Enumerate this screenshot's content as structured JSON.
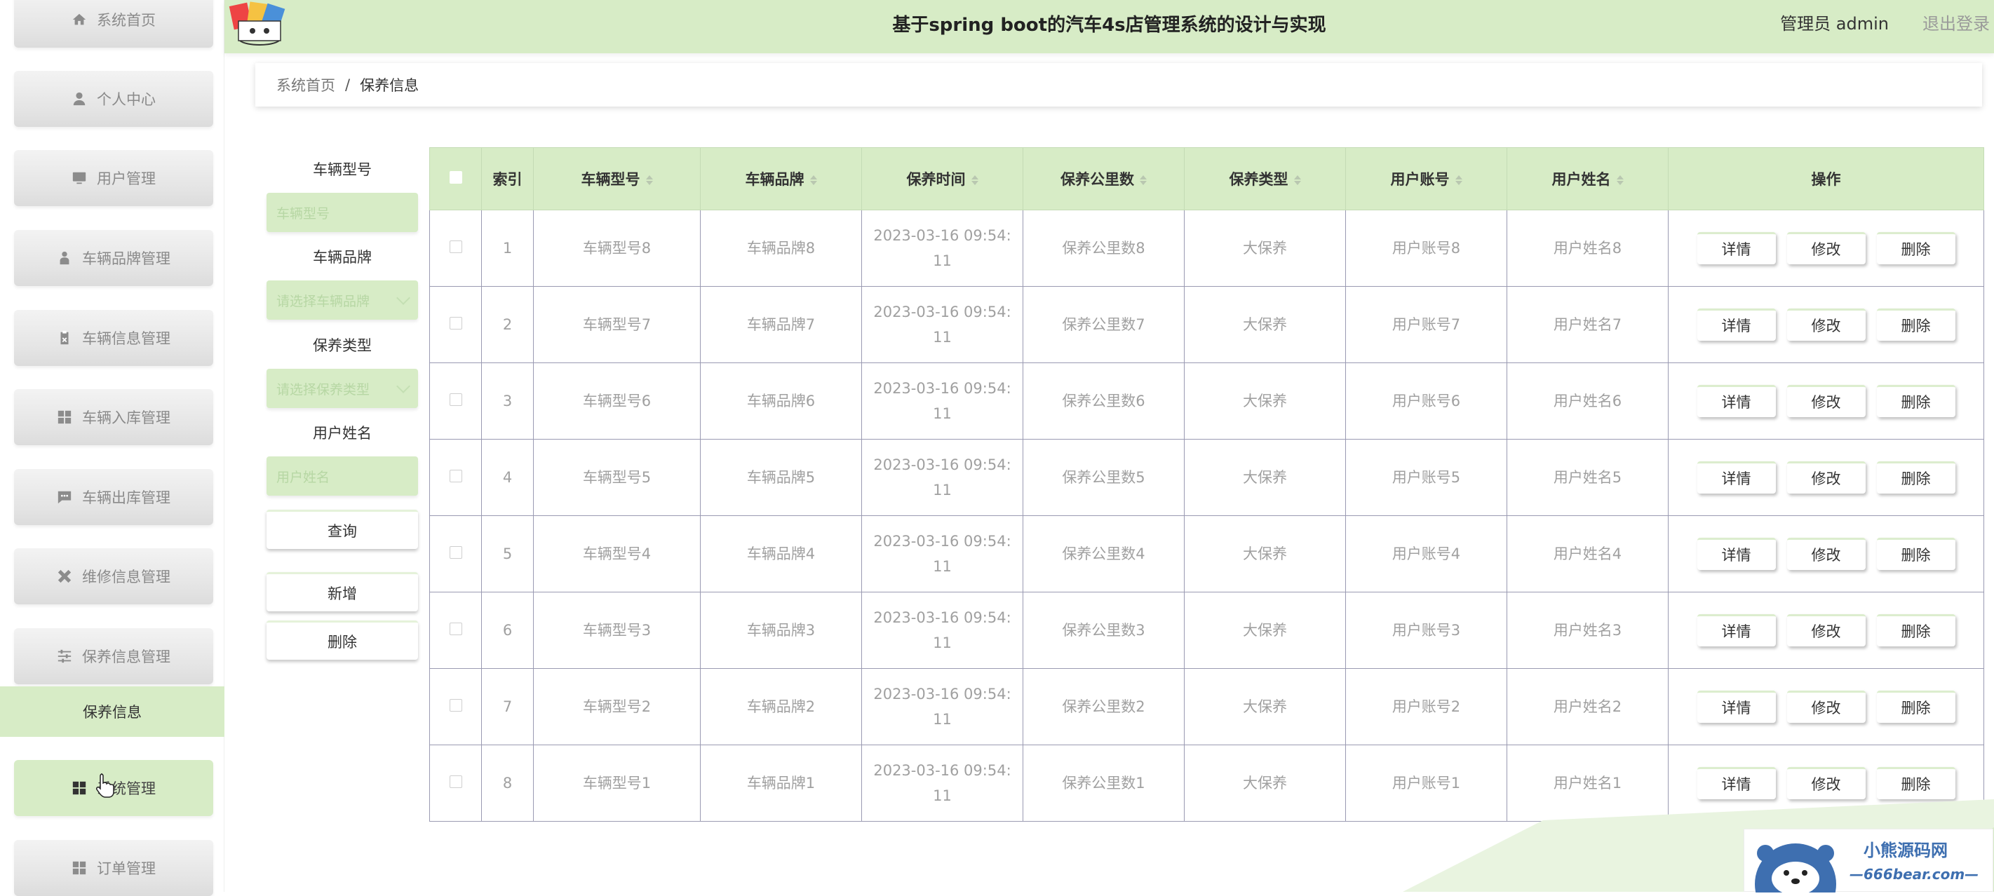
{
  "header": {
    "title": "基于spring boot的汽车4s店管理系统的设计与实现",
    "user": "管理员 admin",
    "logout": "退出登录"
  },
  "sidebar": {
    "items": [
      {
        "label": "系统首页",
        "icon": "home-icon"
      },
      {
        "label": "个人中心",
        "icon": "user-icon"
      },
      {
        "label": "用户管理",
        "icon": "monitor-icon"
      },
      {
        "label": "车辆品牌管理",
        "icon": "person-icon"
      },
      {
        "label": "车辆信息管理",
        "icon": "clipboard-icon"
      },
      {
        "label": "车辆入库管理",
        "icon": "grid-icon"
      },
      {
        "label": "车辆出库管理",
        "icon": "message-icon"
      },
      {
        "label": "维修信息管理",
        "icon": "tools-icon"
      },
      {
        "label": "保养信息管理",
        "icon": "sliders-icon"
      },
      {
        "label": "系统管理",
        "icon": "grid-icon"
      },
      {
        "label": "订单管理",
        "icon": "grid-icon"
      }
    ],
    "sub_item": "保养信息",
    "colors": {
      "accent": "#d7ecc6"
    }
  },
  "breadcrumb": {
    "home": "系统首页",
    "sep": "/",
    "current": "保养信息"
  },
  "filters": {
    "model_label": "车辆型号",
    "model_placeholder": "车辆型号",
    "brand_label": "车辆品牌",
    "brand_placeholder": "请选择车辆品牌",
    "type_label": "保养类型",
    "type_placeholder": "请选择保养类型",
    "name_label": "用户姓名",
    "name_placeholder": "用户姓名",
    "query": "查询",
    "add": "新增",
    "delete": "删除"
  },
  "table": {
    "headers": [
      "索引",
      "车辆型号",
      "车辆品牌",
      "保养时间",
      "保养公里数",
      "保养类型",
      "用户账号",
      "用户姓名",
      "操作"
    ],
    "actions": [
      "详情",
      "修改",
      "删除"
    ],
    "rows": [
      {
        "index": "1",
        "model": "车辆型号8",
        "brand": "车辆品牌8",
        "time": "2023-03-16 09:54:11",
        "km": "保养公里数8",
        "type": "大保养",
        "account": "用户账号8",
        "name": "用户姓名8"
      },
      {
        "index": "2",
        "model": "车辆型号7",
        "brand": "车辆品牌7",
        "time": "2023-03-16 09:54:11",
        "km": "保养公里数7",
        "type": "大保养",
        "account": "用户账号7",
        "name": "用户姓名7"
      },
      {
        "index": "3",
        "model": "车辆型号6",
        "brand": "车辆品牌6",
        "time": "2023-03-16 09:54:11",
        "km": "保养公里数6",
        "type": "大保养",
        "account": "用户账号6",
        "name": "用户姓名6"
      },
      {
        "index": "4",
        "model": "车辆型号5",
        "brand": "车辆品牌5",
        "time": "2023-03-16 09:54:11",
        "km": "保养公里数5",
        "type": "大保养",
        "account": "用户账号5",
        "name": "用户姓名5"
      },
      {
        "index": "5",
        "model": "车辆型号4",
        "brand": "车辆品牌4",
        "time": "2023-03-16 09:54:11",
        "km": "保养公里数4",
        "type": "大保养",
        "account": "用户账号4",
        "name": "用户姓名4"
      },
      {
        "index": "6",
        "model": "车辆型号3",
        "brand": "车辆品牌3",
        "time": "2023-03-16 09:54:11",
        "km": "保养公里数3",
        "type": "大保养",
        "account": "用户账号3",
        "name": "用户姓名3"
      },
      {
        "index": "7",
        "model": "车辆型号2",
        "brand": "车辆品牌2",
        "time": "2023-03-16 09:54:11",
        "km": "保养公里数2",
        "type": "大保养",
        "account": "用户账号2",
        "name": "用户姓名2"
      },
      {
        "index": "8",
        "model": "车辆型号1",
        "brand": "车辆品牌1",
        "time": "2023-03-16 09:54:11",
        "km": "保养公里数1",
        "type": "大保养",
        "account": "用户账号1",
        "name": "用户姓名1"
      }
    ]
  },
  "watermark": {
    "name": "小熊源码网",
    "url": "—666bear.com—"
  }
}
